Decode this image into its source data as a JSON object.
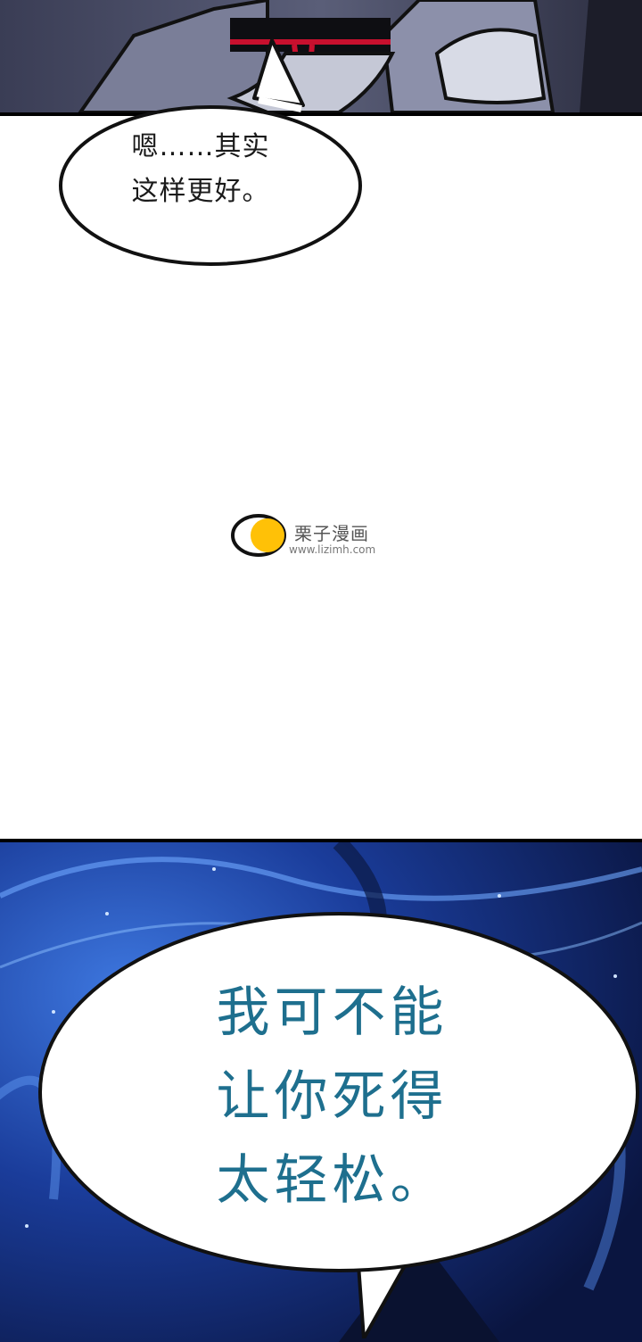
{
  "bubble1": {
    "text": "嗯……其实\n这样更好。"
  },
  "bubble2": {
    "text": "我可不能\n让你死得\n太轻松。"
  },
  "watermark": {
    "name": "栗子漫画",
    "url": "www.lizimh.com",
    "accent": "#ffc107"
  },
  "colors": {
    "panel_dark": "#2c2e3d",
    "panel_blue": "#10245c",
    "bubble2_text": "#1e6f8e"
  }
}
